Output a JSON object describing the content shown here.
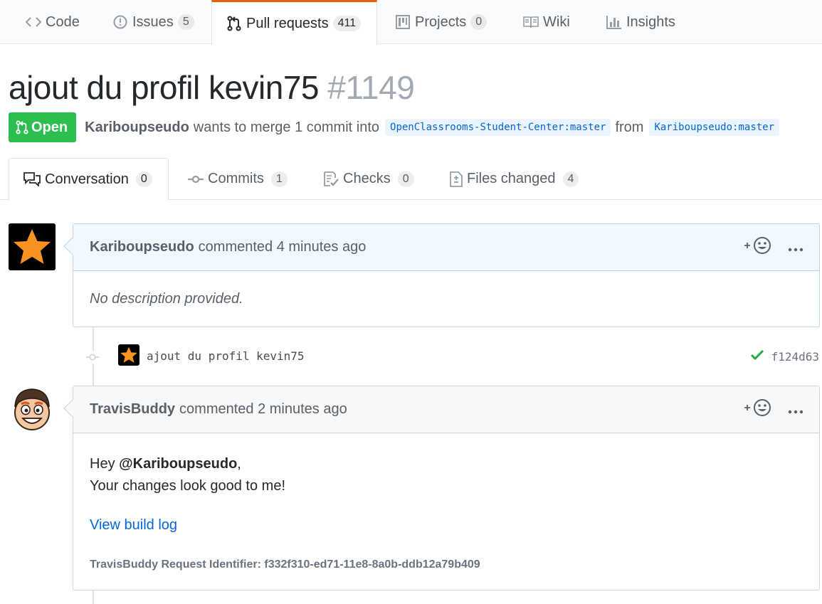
{
  "reponav": {
    "code": "Code",
    "issues": "Issues",
    "issues_count": "5",
    "pulls": "Pull requests",
    "pulls_count": "411",
    "projects": "Projects",
    "projects_count": "0",
    "wiki": "Wiki",
    "insights": "Insights"
  },
  "pr": {
    "title": "ajout du profil kevin75",
    "number": "#1149",
    "state": "Open",
    "author": "Kariboupseudo",
    "merge_text": "wants to merge 1 commit into",
    "base_branch": "OpenClassrooms-Student-Center:master",
    "from_text": "from",
    "head_branch": "Kariboupseudo:master"
  },
  "tabs": {
    "conversation": "Conversation",
    "conversation_count": "0",
    "commits": "Commits",
    "commits_count": "1",
    "checks": "Checks",
    "checks_count": "0",
    "files": "Files changed",
    "files_count": "4"
  },
  "comments": [
    {
      "author": "Kariboupseudo",
      "action": "commented 4 minutes ago",
      "body": "No description provided."
    },
    {
      "author": "TravisBuddy",
      "action": "commented 2 minutes ago",
      "greeting_prefix": "Hey ",
      "mention": "@Kariboupseudo",
      "greeting_suffix": ",",
      "line2": "Your changes look good to me!",
      "link": "View build log",
      "identifier": "TravisBuddy Request Identifier: f332f310-ed71-11e8-8a0b-ddb12a79b409"
    }
  ],
  "commit": {
    "message": "ajout du profil kevin75",
    "sha": "f124d63"
  },
  "colors": {
    "accent_orange": "#e36209",
    "open_green": "#2cbe4e",
    "link_blue": "#0366d6"
  }
}
